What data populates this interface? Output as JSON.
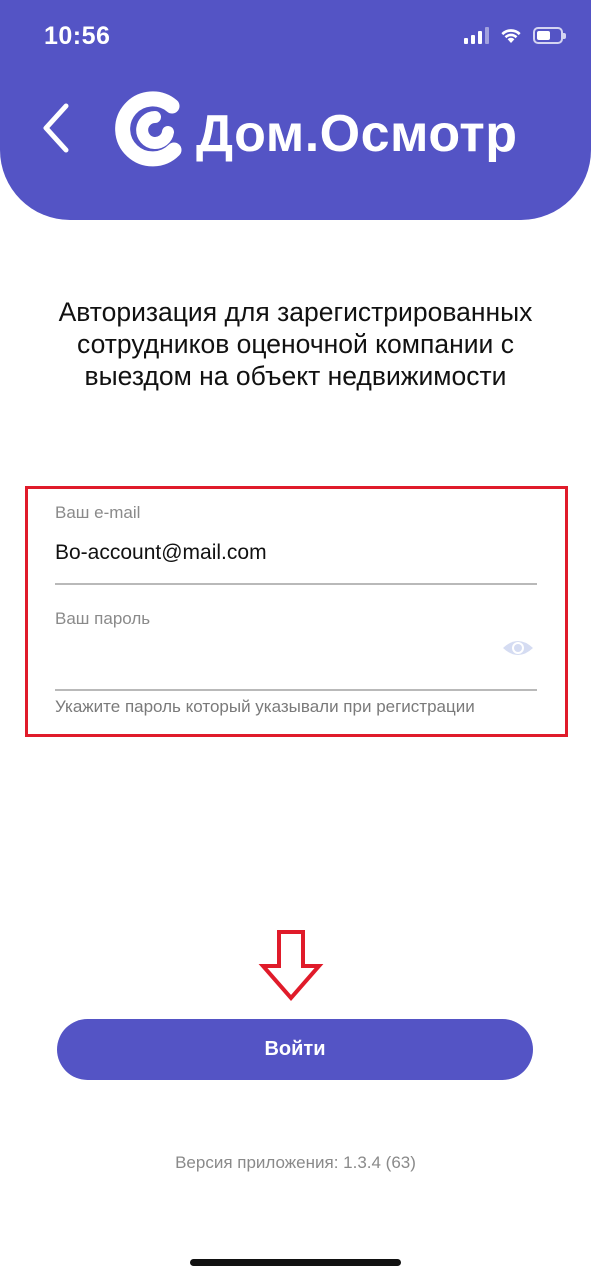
{
  "status_bar": {
    "time": "10:56",
    "battery_level": 0.6
  },
  "header": {
    "logo_text": "Дом.Осмотр",
    "background_color": "#5454c5",
    "back_icon": "chevron-left-icon"
  },
  "title": "Авторизация для зарегистрированных сотрудников оценочной компании с выездом на объект недвижимости",
  "form": {
    "email": {
      "label": "Ваш e-mail",
      "value": "Bo-account@mail.com"
    },
    "password": {
      "label": "Ваш пароль",
      "value": "",
      "toggle_icon": "eye-icon",
      "helper": "Укажите пароль который указывали при регистрации"
    },
    "highlight_color": "#e01b2a"
  },
  "annotation": {
    "arrow_icon": "arrow-down-icon",
    "color": "#e01b2a"
  },
  "login_button": {
    "label": "Войти",
    "color": "#5454c5"
  },
  "version_text": "Версия приложения: 1.3.4 (63)"
}
